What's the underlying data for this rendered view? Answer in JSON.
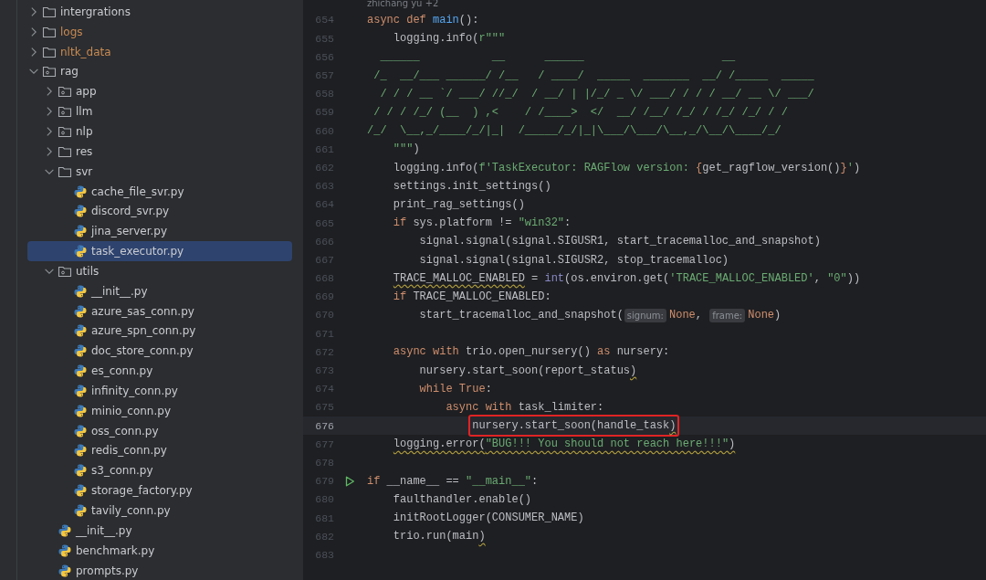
{
  "project_tree": [
    {
      "name": "intergrations",
      "kind": "folder",
      "expanded": false,
      "excluded": false,
      "selected": false
    },
    {
      "name": "logs",
      "kind": "folder",
      "expanded": false,
      "excluded": true,
      "selected": false
    },
    {
      "name": "nltk_data",
      "kind": "folder",
      "expanded": false,
      "excluded": true,
      "selected": false
    },
    {
      "name": "rag",
      "kind": "package",
      "expanded": true,
      "excluded": false,
      "selected": false,
      "children": [
        {
          "name": "app",
          "kind": "package",
          "expanded": false,
          "excluded": false,
          "selected": false
        },
        {
          "name": "llm",
          "kind": "package",
          "expanded": false,
          "excluded": false,
          "selected": false
        },
        {
          "name": "nlp",
          "kind": "package",
          "expanded": false,
          "excluded": false,
          "selected": false
        },
        {
          "name": "res",
          "kind": "folder",
          "expanded": false,
          "excluded": false,
          "selected": false
        },
        {
          "name": "svr",
          "kind": "folder",
          "expanded": true,
          "excluded": false,
          "selected": false,
          "children": [
            {
              "name": "cache_file_svr.py",
              "kind": "python",
              "excluded": false,
              "selected": false
            },
            {
              "name": "discord_svr.py",
              "kind": "python",
              "excluded": false,
              "selected": false
            },
            {
              "name": "jina_server.py",
              "kind": "python",
              "excluded": false,
              "selected": false
            },
            {
              "name": "task_executor.py",
              "kind": "python",
              "excluded": false,
              "selected": true
            }
          ]
        },
        {
          "name": "utils",
          "kind": "package",
          "expanded": true,
          "excluded": false,
          "selected": false,
          "children": [
            {
              "name": "__init__.py",
              "kind": "python",
              "excluded": false,
              "selected": false
            },
            {
              "name": "azure_sas_conn.py",
              "kind": "python",
              "excluded": false,
              "selected": false
            },
            {
              "name": "azure_spn_conn.py",
              "kind": "python",
              "excluded": false,
              "selected": false
            },
            {
              "name": "doc_store_conn.py",
              "kind": "python",
              "excluded": false,
              "selected": false
            },
            {
              "name": "es_conn.py",
              "kind": "python",
              "excluded": false,
              "selected": false
            },
            {
              "name": "infinity_conn.py",
              "kind": "python",
              "excluded": false,
              "selected": false
            },
            {
              "name": "minio_conn.py",
              "kind": "python",
              "excluded": false,
              "selected": false
            },
            {
              "name": "oss_conn.py",
              "kind": "python",
              "excluded": false,
              "selected": false
            },
            {
              "name": "redis_conn.py",
              "kind": "python",
              "excluded": false,
              "selected": false
            },
            {
              "name": "s3_conn.py",
              "kind": "python",
              "excluded": false,
              "selected": false
            },
            {
              "name": "storage_factory.py",
              "kind": "python",
              "excluded": false,
              "selected": false
            },
            {
              "name": "tavily_conn.py",
              "kind": "python",
              "excluded": false,
              "selected": false
            }
          ]
        },
        {
          "name": "__init__.py",
          "kind": "python",
          "excluded": false,
          "selected": false
        },
        {
          "name": "benchmark.py",
          "kind": "python",
          "excluded": false,
          "selected": false
        },
        {
          "name": "prompts.py",
          "kind": "python",
          "excluded": false,
          "selected": false
        }
      ]
    }
  ],
  "editor": {
    "author_hint": "zhichang yu +2",
    "lines": [
      {
        "number": "654",
        "current": false,
        "boxed": false,
        "run": false,
        "tokens": [
          {
            "kind": "kw",
            "text": "async def "
          },
          {
            "kind": "fn",
            "text": "main"
          },
          {
            "kind": "plain",
            "text": "():"
          }
        ]
      },
      {
        "number": "655",
        "current": false,
        "boxed": false,
        "run": false,
        "tokens": [
          {
            "kind": "plain",
            "text": "    logging.info("
          },
          {
            "kind": "str",
            "text": "r\"\"\""
          }
        ]
      },
      {
        "number": "656",
        "current": false,
        "boxed": false,
        "run": false,
        "tokens": [
          {
            "kind": "str",
            "text": "  ______           __      ______                     __"
          }
        ]
      },
      {
        "number": "657",
        "current": false,
        "boxed": false,
        "run": false,
        "tokens": [
          {
            "kind": "str",
            "text": " /_  __/___ ______/ /__   / ____/  _____  _______  __/ /_____  _____"
          }
        ]
      },
      {
        "number": "658",
        "current": false,
        "boxed": false,
        "run": false,
        "tokens": [
          {
            "kind": "str",
            "text": "  / / / __ `/ ___/ //_/  / __/ | |/_/ _ \\/ ___/ / / / __/ __ \\/ ___/"
          }
        ]
      },
      {
        "number": "659",
        "current": false,
        "boxed": false,
        "run": false,
        "tokens": [
          {
            "kind": "str",
            "text": " / / / /_/ (__  ) ,<    / /____>  </  __/ /__/ /_/ / /_/ /_/ / /"
          }
        ]
      },
      {
        "number": "660",
        "current": false,
        "boxed": false,
        "run": false,
        "tokens": [
          {
            "kind": "str",
            "text": "/_/  \\__,_/____/_/|_|  /_____/_/|_|\\___/\\___/\\__,_/\\__/\\____/_/"
          }
        ]
      },
      {
        "number": "661",
        "current": false,
        "boxed": false,
        "run": false,
        "tokens": [
          {
            "kind": "str",
            "text": "    \"\"\""
          },
          {
            "kind": "plain",
            "text": ")"
          }
        ]
      },
      {
        "number": "662",
        "current": false,
        "boxed": false,
        "run": false,
        "tokens": [
          {
            "kind": "plain",
            "text": "    logging.info("
          },
          {
            "kind": "str",
            "text": "f'TaskExecutor: RAGFlow version: "
          },
          {
            "kind": "kw",
            "text": "{"
          },
          {
            "kind": "plain",
            "text": "get_ragflow_version()"
          },
          {
            "kind": "kw",
            "text": "}"
          },
          {
            "kind": "str",
            "text": "'"
          },
          {
            "kind": "plain",
            "text": ")"
          }
        ]
      },
      {
        "number": "663",
        "current": false,
        "boxed": false,
        "run": false,
        "tokens": [
          {
            "kind": "plain",
            "text": "    settings.init_settings()"
          }
        ]
      },
      {
        "number": "664",
        "current": false,
        "boxed": false,
        "run": false,
        "tokens": [
          {
            "kind": "plain",
            "text": "    print_rag_settings()"
          }
        ]
      },
      {
        "number": "665",
        "current": false,
        "boxed": false,
        "run": false,
        "tokens": [
          {
            "kind": "kw",
            "text": "    if "
          },
          {
            "kind": "plain",
            "text": "sys.platform != "
          },
          {
            "kind": "str",
            "text": "\"win32\""
          },
          {
            "kind": "plain",
            "text": ":"
          }
        ]
      },
      {
        "number": "666",
        "current": false,
        "boxed": false,
        "run": false,
        "tokens": [
          {
            "kind": "plain",
            "text": "        signal.signal(signal.SIGUSR1, start_tracemalloc_and_snapshot)"
          }
        ]
      },
      {
        "number": "667",
        "current": false,
        "boxed": false,
        "run": false,
        "tokens": [
          {
            "kind": "plain",
            "text": "        signal.signal(signal.SIGUSR2, stop_tracemalloc)"
          }
        ]
      },
      {
        "number": "668",
        "current": false,
        "boxed": false,
        "run": false,
        "tokens": [
          {
            "kind": "warn",
            "text": "    TRACE_MALLOC_ENABLED"
          },
          {
            "kind": "plain",
            "text": " = "
          },
          {
            "kind": "builtin",
            "text": "int"
          },
          {
            "kind": "plain",
            "text": "(os.environ.get("
          },
          {
            "kind": "str",
            "text": "'TRACE_MALLOC_ENABLED'"
          },
          {
            "kind": "plain",
            "text": ", "
          },
          {
            "kind": "str",
            "text": "\"0\""
          },
          {
            "kind": "plain",
            "text": "))"
          }
        ]
      },
      {
        "number": "669",
        "current": false,
        "boxed": false,
        "run": false,
        "tokens": [
          {
            "kind": "kw",
            "text": "    if "
          },
          {
            "kind": "plain",
            "text": "TRACE_MALLOC_ENABLED:"
          }
        ]
      },
      {
        "number": "670",
        "current": false,
        "boxed": false,
        "run": false,
        "tokens": [
          {
            "kind": "plain",
            "text": "        start_tracemalloc_and_snapshot("
          },
          {
            "kind": "hint",
            "text": "signum:"
          },
          {
            "kind": "kw",
            "text": "None"
          },
          {
            "kind": "plain",
            "text": ", "
          },
          {
            "kind": "hint",
            "text": "frame:"
          },
          {
            "kind": "kw",
            "text": "None"
          },
          {
            "kind": "plain",
            "text": ")"
          }
        ]
      },
      {
        "number": "671",
        "current": false,
        "boxed": false,
        "run": false
      },
      {
        "number": "672",
        "current": false,
        "boxed": false,
        "run": false,
        "tokens": [
          {
            "kind": "kw",
            "text": "    async with "
          },
          {
            "kind": "plain",
            "text": "trio.open_nursery() "
          },
          {
            "kind": "kw",
            "text": "as "
          },
          {
            "kind": "plain",
            "text": "nursery:"
          }
        ]
      },
      {
        "number": "673",
        "current": false,
        "boxed": false,
        "run": false,
        "tokens": [
          {
            "kind": "plain",
            "text": "        nursery.start_soon(report_status"
          },
          {
            "kind": "warn",
            "text": ")"
          }
        ]
      },
      {
        "number": "674",
        "current": false,
        "boxed": false,
        "run": false,
        "tokens": [
          {
            "kind": "kw",
            "text": "        while True"
          },
          {
            "kind": "plain",
            "text": ":"
          }
        ]
      },
      {
        "number": "675",
        "current": false,
        "boxed": false,
        "run": false,
        "tokens": [
          {
            "kind": "kw",
            "text": "            async with "
          },
          {
            "kind": "plain",
            "text": "task_limiter:"
          }
        ]
      },
      {
        "number": "676",
        "current": true,
        "boxed": true,
        "run": false,
        "tokens": [
          {
            "kind": "plain",
            "text": "                nursery.start_soon(handle_task"
          },
          {
            "kind": "warn",
            "text": ")"
          }
        ]
      },
      {
        "number": "677",
        "current": false,
        "boxed": false,
        "run": false,
        "tokens": [
          {
            "kind": "warn",
            "text": "    logging.error("
          },
          {
            "kind": "str-warn",
            "text": "\"BUG!!! You should not reach here!!!\""
          },
          {
            "kind": "warn",
            "text": ")"
          }
        ]
      },
      {
        "number": "678",
        "current": false,
        "boxed": false,
        "run": false
      },
      {
        "number": "679",
        "current": false,
        "boxed": false,
        "run": true,
        "tokens": [
          {
            "kind": "kw",
            "text": "if "
          },
          {
            "kind": "plain",
            "text": "__name__ == "
          },
          {
            "kind": "str",
            "text": "\"__main__\""
          },
          {
            "kind": "plain",
            "text": ":"
          }
        ]
      },
      {
        "number": "680",
        "current": false,
        "boxed": false,
        "run": false,
        "tokens": [
          {
            "kind": "plain",
            "text": "    faulthandler.enable()"
          }
        ]
      },
      {
        "number": "681",
        "current": false,
        "boxed": false,
        "run": false,
        "tokens": [
          {
            "kind": "plain",
            "text": "    initRootLogger(CONSUMER_NAME)"
          }
        ]
      },
      {
        "number": "682",
        "current": false,
        "boxed": false,
        "run": false,
        "tokens": [
          {
            "kind": "plain",
            "text": "    trio.run(main"
          },
          {
            "kind": "warn",
            "text": ")"
          }
        ]
      },
      {
        "number": "683",
        "current": false,
        "boxed": false,
        "run": false
      }
    ]
  }
}
